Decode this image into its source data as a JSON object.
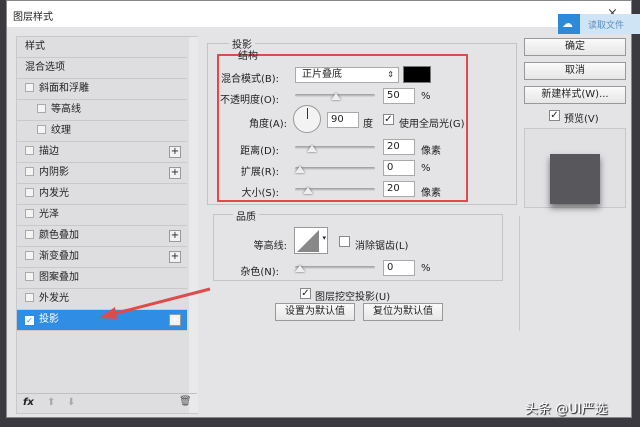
{
  "window": {
    "title": "图层样式",
    "close": "×"
  },
  "badge": {
    "label": "读取文件"
  },
  "styles_list": {
    "items": [
      {
        "label": "样式",
        "checkbox": false,
        "plus": false,
        "indent": false
      },
      {
        "label": "混合选项",
        "checkbox": false,
        "plus": false,
        "indent": false
      },
      {
        "label": "斜面和浮雕",
        "checkbox": true,
        "checked": false,
        "plus": false,
        "indent": false
      },
      {
        "label": "等高线",
        "checkbox": true,
        "checked": false,
        "plus": false,
        "indent": true
      },
      {
        "label": "纹理",
        "checkbox": true,
        "checked": false,
        "plus": false,
        "indent": true
      },
      {
        "label": "描边",
        "checkbox": true,
        "checked": false,
        "plus": true,
        "indent": false
      },
      {
        "label": "内阴影",
        "checkbox": true,
        "checked": false,
        "plus": true,
        "indent": false
      },
      {
        "label": "内发光",
        "checkbox": true,
        "checked": false,
        "plus": false,
        "indent": false
      },
      {
        "label": "光泽",
        "checkbox": true,
        "checked": false,
        "plus": false,
        "indent": false
      },
      {
        "label": "颜色叠加",
        "checkbox": true,
        "checked": false,
        "plus": true,
        "indent": false
      },
      {
        "label": "渐变叠加",
        "checkbox": true,
        "checked": false,
        "plus": true,
        "indent": false
      },
      {
        "label": "图案叠加",
        "checkbox": true,
        "checked": false,
        "plus": false,
        "indent": false
      },
      {
        "label": "外发光",
        "checkbox": true,
        "checked": false,
        "plus": false,
        "indent": false
      },
      {
        "label": "投影",
        "checkbox": true,
        "checked": true,
        "plus": true,
        "indent": false,
        "selected": true
      }
    ],
    "footer": {
      "fx": "fx"
    }
  },
  "drop_shadow": {
    "title": "投影",
    "structure": {
      "title": "结构",
      "blend_mode_label": "混合模式(B):",
      "blend_mode_value": "正片叠底",
      "color": "#000000",
      "opacity_label": "不透明度(O):",
      "opacity_value": "50",
      "opacity_unit": "%",
      "angle_label": "角度(A):",
      "angle_value": "90",
      "angle_unit": "度",
      "global_light_label": "使用全局光(G)",
      "global_light_checked": true,
      "distance_label": "距离(D):",
      "distance_value": "20",
      "distance_unit": "像素",
      "spread_label": "扩展(R):",
      "spread_value": "0",
      "spread_unit": "%",
      "size_label": "大小(S):",
      "size_value": "20",
      "size_unit": "像素"
    },
    "quality": {
      "title": "品质",
      "contour_label": "等高线:",
      "antialias_label": "消除锯齿(L)",
      "antialias_checked": false,
      "noise_label": "杂色(N):",
      "noise_value": "0",
      "noise_unit": "%"
    },
    "knockout_label": "图层挖空投影(U)",
    "knockout_checked": true,
    "set_default": "设置为默认值",
    "reset_default": "复位为默认值"
  },
  "buttons": {
    "ok": "确定",
    "cancel": "取消",
    "new_style": "新建样式(W)...",
    "preview_label": "预览(V)",
    "preview_checked": true
  },
  "watermark": "头条 @UI严选"
}
